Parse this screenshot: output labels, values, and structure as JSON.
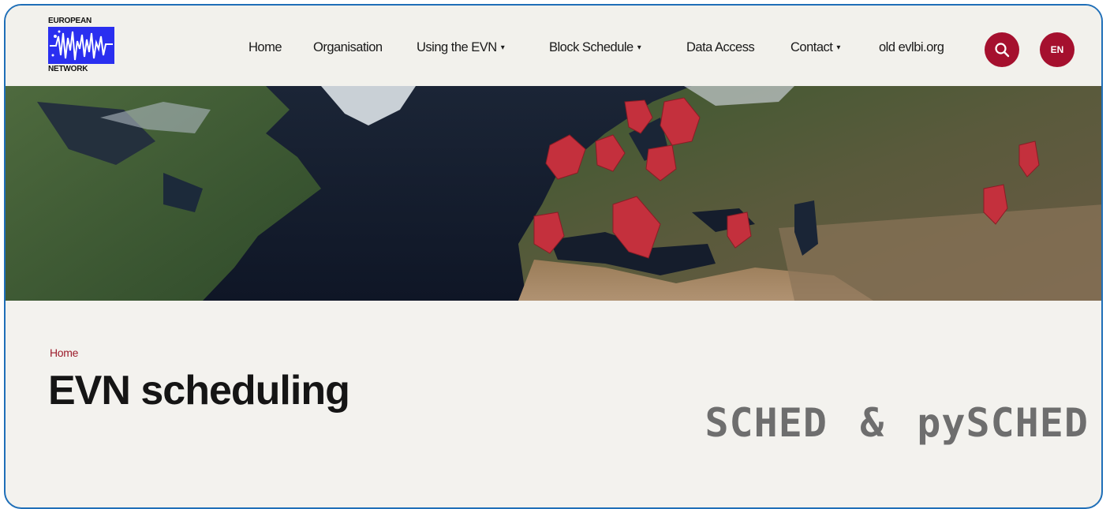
{
  "logo": {
    "top_text": "EUROPEAN",
    "bottom_text": "NETWORK",
    "mark_color": "#2a2ff0"
  },
  "nav": {
    "items": [
      {
        "label": "Home",
        "dropdown": false
      },
      {
        "label": "Organisation",
        "dropdown": false
      },
      {
        "label": "Using the EVN",
        "dropdown": true
      },
      {
        "label": "Block Schedule",
        "dropdown": true
      },
      {
        "label": "Data Access",
        "dropdown": false
      },
      {
        "label": "Contact",
        "dropdown": true
      },
      {
        "label": "old evlbi.org",
        "dropdown": false
      }
    ],
    "caret": "▾",
    "search_icon": "search-icon",
    "language_label": "EN",
    "accent_color": "#a5102e"
  },
  "banner": {
    "marker_color": "#c4303d",
    "marker_icon": "radio-telescope-icon"
  },
  "breadcrumb": {
    "home": "Home"
  },
  "page": {
    "title": "EVN scheduling"
  },
  "graphic": {
    "text": "SCHED & pySCHED"
  }
}
